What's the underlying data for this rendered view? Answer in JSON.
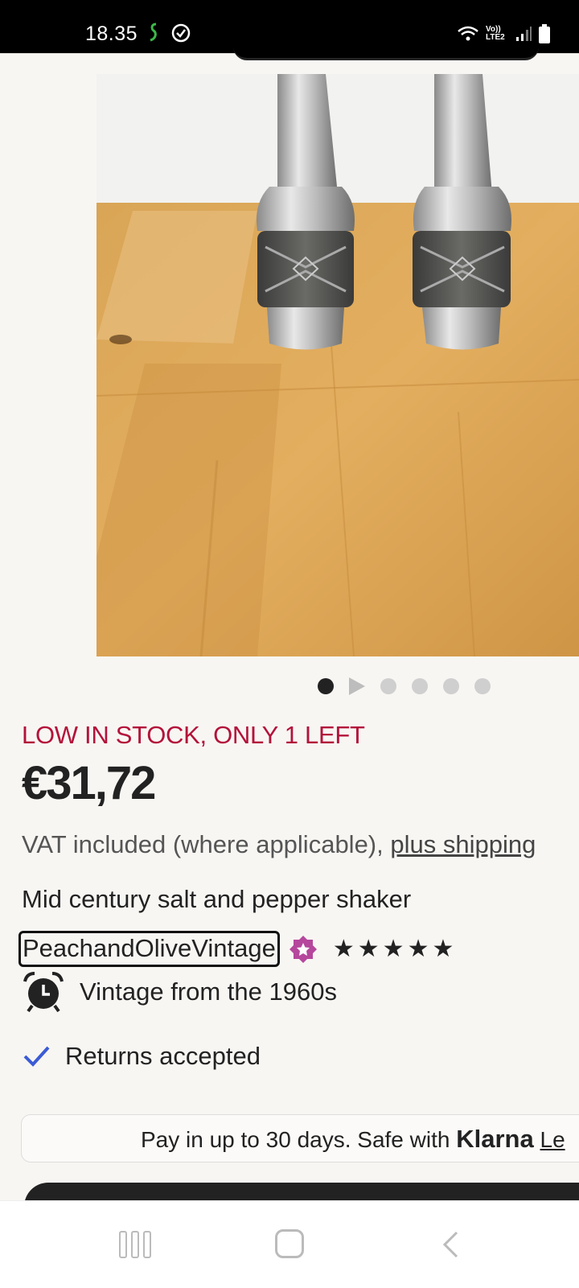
{
  "status_bar": {
    "time": "18.35",
    "network_label": "Vo)) LTE2"
  },
  "product": {
    "stock_notice": "LOW IN STOCK, ONLY 1 LEFT",
    "price": "€31,72",
    "vat_text": "VAT included (where applicable), ",
    "shipping_link": "plus shipping",
    "title": "Mid century salt and pepper shaker",
    "shop_name": "PeachandOliveVintage",
    "rating_stars": 5,
    "vintage_label": "Vintage from the 1960s",
    "returns_label": "Returns accepted"
  },
  "carousel": {
    "images": 6,
    "active_index": 0
  },
  "klarna": {
    "text": "Pay in up to 30 days. Safe with ",
    "brand": "Klarna",
    "more_link": "Le"
  },
  "colors": {
    "stock_red": "#b3123a",
    "star_seller_purple": "#b5479c",
    "check_blue": "#3b5bd6"
  }
}
